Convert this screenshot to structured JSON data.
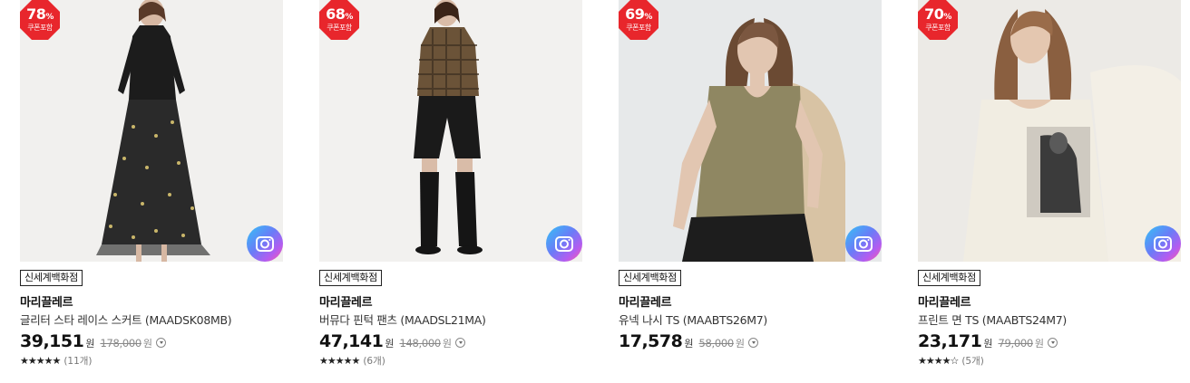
{
  "products": [
    {
      "discount": "78",
      "discount_unit": "%",
      "coupon_label": "쿠폰포함",
      "store": "신세계백화점",
      "brand": "마리끌레르",
      "name": "글리터 스타 레이스 스커트 (MAADSK08MB)",
      "price": "39,151",
      "currency": "원",
      "original_price": "178,000",
      "original_currency": "원",
      "stars": "★★★★★",
      "review_count": "(11개)",
      "rating": 5
    },
    {
      "discount": "68",
      "discount_unit": "%",
      "coupon_label": "쿠폰포함",
      "store": "신세계백화점",
      "brand": "마리끌레르",
      "name": "버뮤다 핀턱 팬츠 (MAADSL21MA)",
      "price": "47,141",
      "currency": "원",
      "original_price": "148,000",
      "original_currency": "원",
      "stars": "★★★★★",
      "review_count": "(6개)",
      "rating": 5
    },
    {
      "discount": "69",
      "discount_unit": "%",
      "coupon_label": "쿠폰포함",
      "store": "신세계백화점",
      "brand": "마리끌레르",
      "name": "유넥 나시 TS (MAABTS26M7)",
      "price": "17,578",
      "currency": "원",
      "original_price": "58,000",
      "original_currency": "원"
    },
    {
      "discount": "70",
      "discount_unit": "%",
      "coupon_label": "쿠폰포함",
      "store": "신세계백화점",
      "brand": "마리끌레르",
      "name": "프린트 면 TS (MAABTS24M7)",
      "price": "23,171",
      "currency": "원",
      "original_price": "79,000",
      "original_currency": "원",
      "stars": "★★★★☆",
      "review_count": "(5개)",
      "rating": 4.5
    }
  ],
  "colors": {
    "badge": "#e8262c",
    "text": "#222222",
    "muted": "#888888"
  },
  "icons": {
    "badge": "octagon-badge",
    "camera": "camera-icon",
    "info": "chevron-down-circle-icon"
  }
}
